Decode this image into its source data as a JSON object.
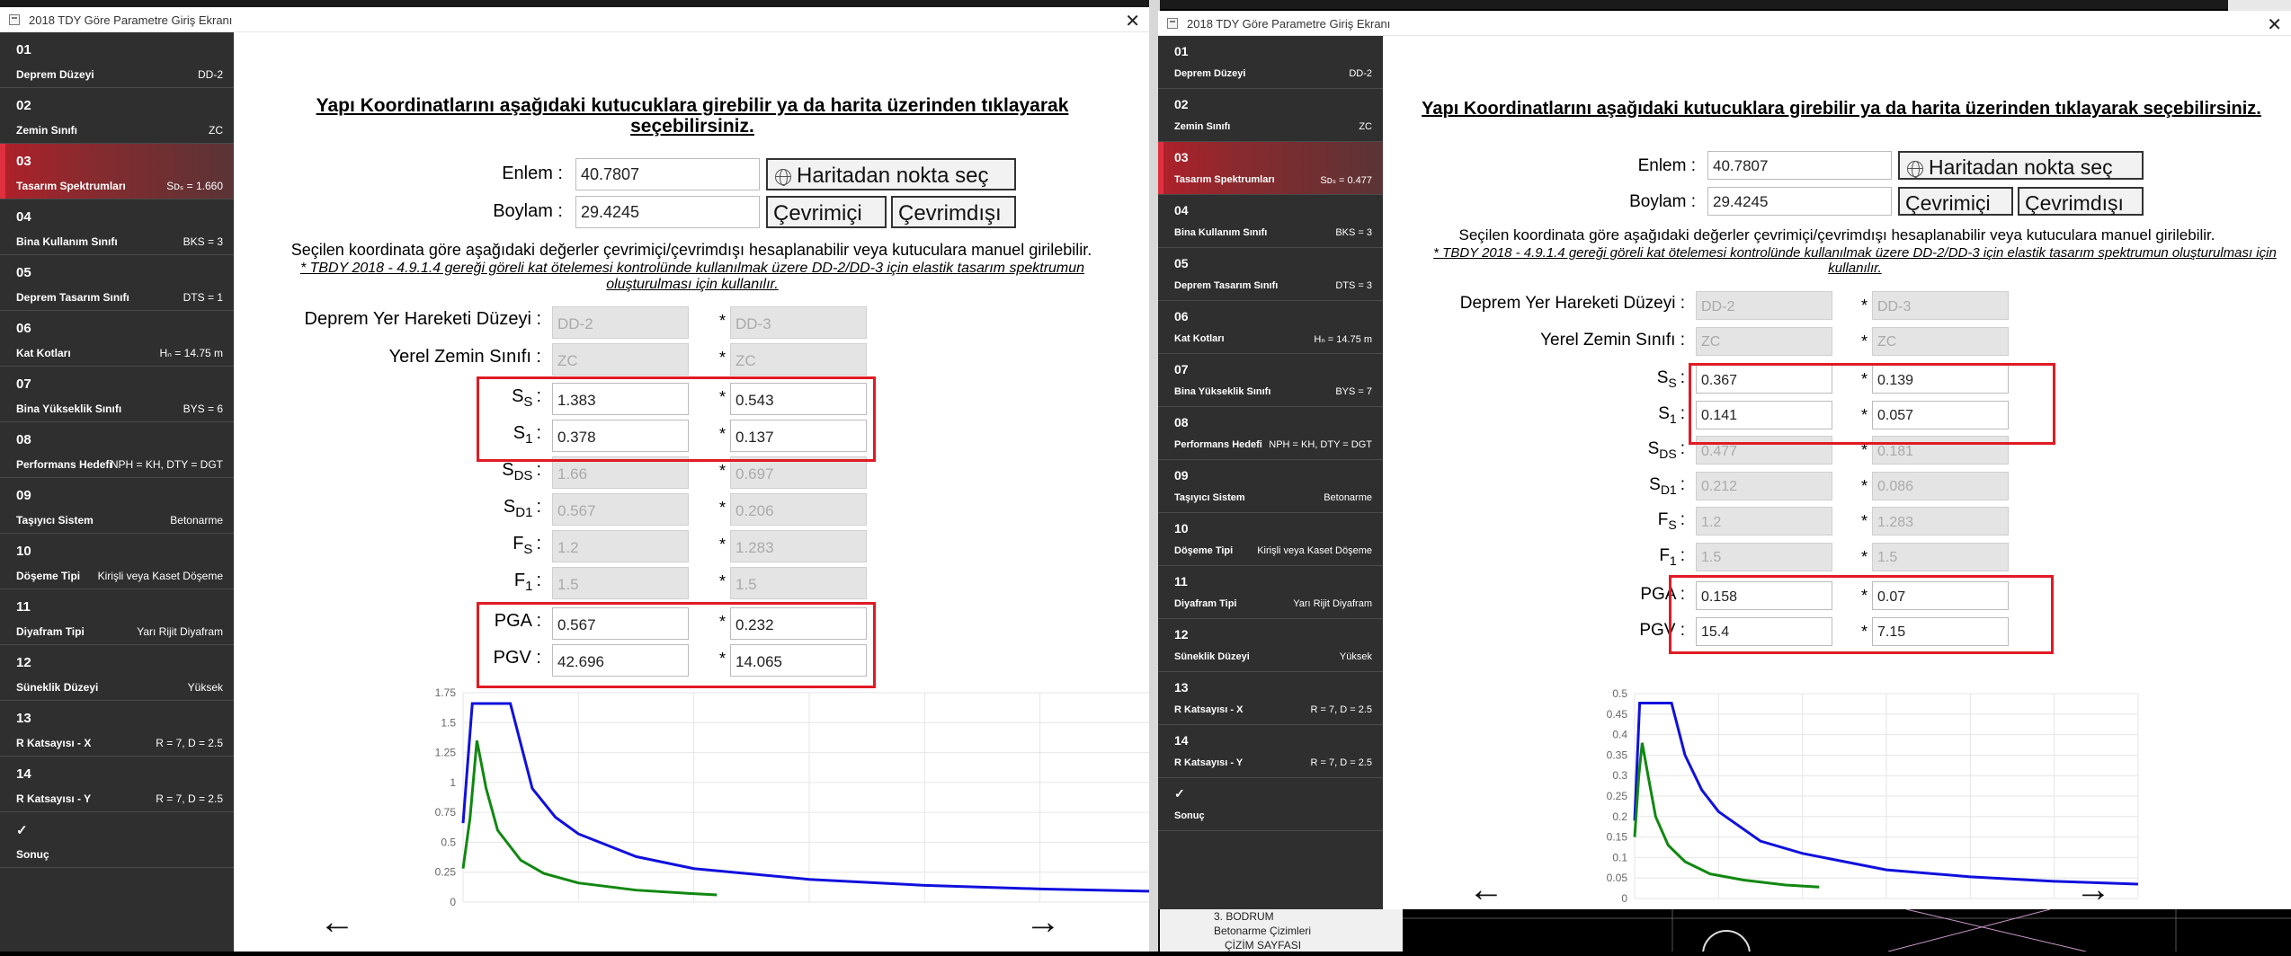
{
  "window_title": "2018 TDY Göre Parametre Giriş Ekranı",
  "heading": "Yapı Koordinatlarını aşağıdaki kutucuklara girebilir ya da harita üzerinden tıklayarak seçebilirsiniz.",
  "enlem_label": "Enlem :",
  "boylam_label": "Boylam :",
  "btn_harita": "Haritadan nokta seç",
  "btn_cevrimici": "Çevrimiçi",
  "btn_cevrimdisi": "Çevrimdışı",
  "info_text": "Seçilen koordinata göre aşağıdaki değerler çevrimiçi/çevrimdışı hesaplanabilir veya kutuculara manuel girilebilir.",
  "note_text": "* TBDY 2018 - 4.9.1.4 gereği göreli kat ötelemesi kontrolünde kullanılmak üzere DD-2/DD-3 için elastik tasarım spektrumun oluşturulması için kullanılır.",
  "row_labels": {
    "dd": "Deprem Yer Hareketi Düzeyi :",
    "zemin": "Yerel Zemin Sınıfı :",
    "ss_main": "S",
    "ss_sub": "S",
    "s1_main": "S",
    "s1_sub": "1",
    "sds_main": "S",
    "sds_sub": "DS",
    "sd1_main": "S",
    "sd1_sub": "D1",
    "fs_main": "F",
    "fs_sub": "S",
    "f1_main": "F",
    "f1_sub": "1",
    "colon": ":",
    "pga": "PGA :",
    "pgv": "PGV :",
    "star": "*"
  },
  "arrows": {
    "prev": "←",
    "next": "→"
  },
  "windows": [
    {
      "steps": [
        {
          "num": "01",
          "label": "Deprem Düzeyi",
          "value": "DD-2"
        },
        {
          "num": "02",
          "label": "Zemin Sınıfı",
          "value": "ZC"
        },
        {
          "num": "03",
          "label": "Tasarım Spektrumları",
          "value": "Sᴅₛ = 1.660"
        },
        {
          "num": "04",
          "label": "Bina Kullanım Sınıfı",
          "value": "BKS = 3"
        },
        {
          "num": "05",
          "label": "Deprem Tasarım Sınıfı",
          "value": "DTS = 1"
        },
        {
          "num": "06",
          "label": "Kat Kotları",
          "value": "Hₙ = 14.75 m"
        },
        {
          "num": "07",
          "label": "Bina Yükseklik Sınıfı",
          "value": "BYS = 6"
        },
        {
          "num": "08",
          "label": "Performans Hedefi",
          "value": "NPH = KH, DTY = DGT"
        },
        {
          "num": "09",
          "label": "Taşıyıcı Sistem",
          "value": "Betonarme"
        },
        {
          "num": "10",
          "label": "Döşeme Tipi",
          "value": "Kirişli veya Kaset Döşeme"
        },
        {
          "num": "11",
          "label": "Diyafram Tipi",
          "value": "Yarı Rijit Diyafram"
        },
        {
          "num": "12",
          "label": "Süneklik Düzeyi",
          "value": "Yüksek"
        },
        {
          "num": "13",
          "label": "R Katsayısı - X",
          "value": "R = 7, D = 2.5"
        },
        {
          "num": "14",
          "label": "R Katsayısı - Y",
          "value": "R = 7, D = 2.5"
        },
        {
          "num": "✓",
          "label": "Sonuç",
          "value": ""
        }
      ],
      "enlem": "40.7807",
      "boylam": "29.4245",
      "values": {
        "dd": [
          "DD-2",
          "DD-3"
        ],
        "zemin": [
          "ZC",
          "ZC"
        ],
        "ss": [
          "1.383",
          "0.543"
        ],
        "s1": [
          "0.378",
          "0.137"
        ],
        "sds": [
          "1.66",
          "0.697"
        ],
        "sd1": [
          "0.567",
          "0.206"
        ],
        "fs": [
          "1.2",
          "1.283"
        ],
        "f1": [
          "1.5",
          "1.5"
        ],
        "pga": [
          "0.567",
          "0.232"
        ],
        "pgv": [
          "42.696",
          "14.065"
        ]
      },
      "chart_data": {
        "type": "line",
        "yticks": [
          "0",
          "0.25",
          "0.5",
          "0.75",
          "1",
          "1.25",
          "1.5",
          "1.75"
        ],
        "ylim": [
          0,
          1.75
        ],
        "xlim": [
          0,
          6
        ],
        "series": [
          {
            "color": "#1010dd",
            "x": [
              0,
              0.08,
              0.12,
              0.41,
              0.6,
              0.8,
              1.0,
              1.5,
              2,
              3,
              4,
              5,
              6
            ],
            "y": [
              0.66,
              1.66,
              1.66,
              1.66,
              0.95,
              0.71,
              0.57,
              0.38,
              0.28,
              0.19,
              0.14,
              0.11,
              0.09
            ]
          },
          {
            "color": "#118811",
            "x": [
              0,
              0.06,
              0.12,
              0.2,
              0.3,
              0.5,
              0.7,
              1.0,
              1.5,
              2,
              2.2
            ],
            "y": [
              0.28,
              0.7,
              1.35,
              0.95,
              0.6,
              0.35,
              0.24,
              0.16,
              0.1,
              0.07,
              0.06
            ]
          }
        ]
      }
    },
    {
      "steps": [
        {
          "num": "01",
          "label": "Deprem Düzeyi",
          "value": "DD-2"
        },
        {
          "num": "02",
          "label": "Zemin Sınıfı",
          "value": "ZC"
        },
        {
          "num": "03",
          "label": "Tasarım Spektrumları",
          "value": "Sᴅₛ = 0.477"
        },
        {
          "num": "04",
          "label": "Bina Kullanım Sınıfı",
          "value": "BKS = 3"
        },
        {
          "num": "05",
          "label": "Deprem Tasarım Sınıfı",
          "value": "DTS = 3"
        },
        {
          "num": "06",
          "label": "Kat Kotları",
          "value": "Hₙ = 14.75 m"
        },
        {
          "num": "07",
          "label": "Bina Yükseklik Sınıfı",
          "value": "BYS = 7"
        },
        {
          "num": "08",
          "label": "Performans Hedefi",
          "value": "NPH = KH, DTY = DGT"
        },
        {
          "num": "09",
          "label": "Taşıyıcı Sistem",
          "value": "Betonarme"
        },
        {
          "num": "10",
          "label": "Döşeme Tipi",
          "value": "Kirişli veya Kaset Döşeme"
        },
        {
          "num": "11",
          "label": "Diyafram Tipi",
          "value": "Yarı Rijit Diyafram"
        },
        {
          "num": "12",
          "label": "Süneklik Düzeyi",
          "value": "Yüksek"
        },
        {
          "num": "13",
          "label": "R Katsayısı - X",
          "value": "R = 7, D = 2.5"
        },
        {
          "num": "14",
          "label": "R Katsayısı - Y",
          "value": "R = 7, D = 2.5"
        },
        {
          "num": "✓",
          "label": "Sonuç",
          "value": ""
        }
      ],
      "enlem": "40.7807",
      "boylam": "29.4245",
      "values": {
        "dd": [
          "DD-2",
          "DD-3"
        ],
        "zemin": [
          "ZC",
          "ZC"
        ],
        "ss": [
          "0.367",
          "0.139"
        ],
        "s1": [
          "0.141",
          "0.057"
        ],
        "sds": [
          "0.477",
          "0.181"
        ],
        "sd1": [
          "0.212",
          "0.086"
        ],
        "fs": [
          "1.2",
          "1.283"
        ],
        "f1": [
          "1.5",
          "1.5"
        ],
        "pga": [
          "0.158",
          "0.07"
        ],
        "pgv": [
          "15.4",
          "7.15"
        ]
      },
      "chart_data": {
        "type": "line",
        "yticks": [
          "0",
          "0.05",
          "0.1",
          "0.15",
          "0.2",
          "0.25",
          "0.3",
          "0.35",
          "0.4",
          "0.45",
          "0.5"
        ],
        "ylim": [
          0,
          0.5
        ],
        "xlim": [
          0,
          6
        ],
        "series": [
          {
            "color": "#1010dd",
            "x": [
              0,
              0.06,
              0.09,
              0.44,
              0.6,
              0.8,
              1.0,
              1.5,
              2,
              3,
              4,
              5,
              6
            ],
            "y": [
              0.19,
              0.477,
              0.477,
              0.477,
              0.35,
              0.265,
              0.212,
              0.14,
              0.11,
              0.07,
              0.053,
              0.042,
              0.035
            ]
          },
          {
            "color": "#118811",
            "x": [
              0,
              0.05,
              0.09,
              0.16,
              0.25,
              0.4,
              0.6,
              0.9,
              1.3,
              1.8,
              2.2
            ],
            "y": [
              0.15,
              0.3,
              0.38,
              0.3,
              0.2,
              0.13,
              0.09,
              0.06,
              0.045,
              0.033,
              0.028
            ]
          }
        ]
      }
    }
  ],
  "background": {
    "tree": [
      "3. BODRUM",
      "Betonarme Çizimleri",
      "ÇİZİM SAYFASI"
    ]
  }
}
